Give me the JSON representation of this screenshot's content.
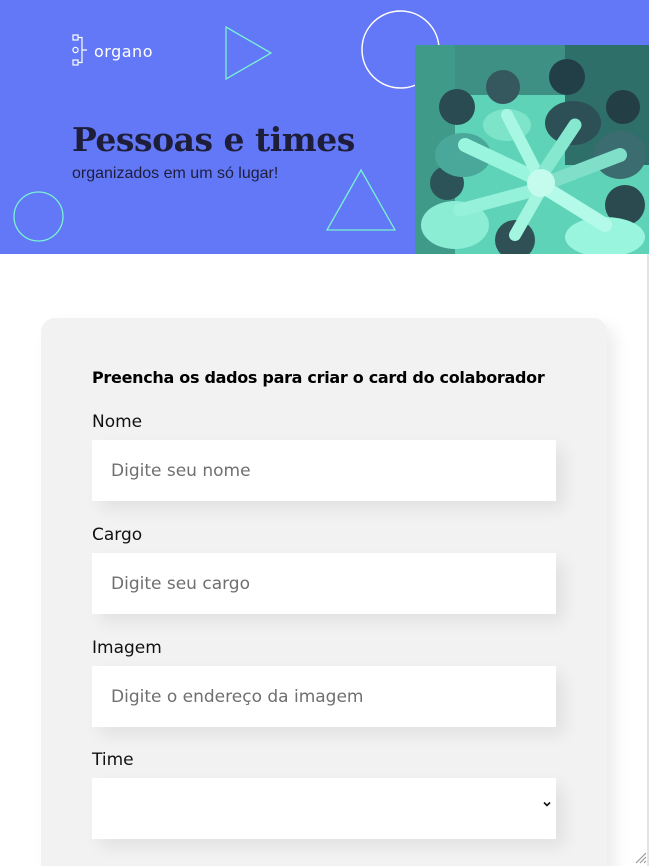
{
  "header": {
    "logo_text": "organo",
    "title": "Pessoas e times",
    "subtitle": "organizados em um só lugar!",
    "colors": {
      "background": "#6278f7",
      "title_text": "#1e1e3a",
      "decoration_white": "#ffffff",
      "decoration_aqua": "#7af2d2",
      "photo_tint": "#5fd3b8"
    },
    "photo_alt": "team-hands-photo"
  },
  "form": {
    "heading": "Preencha os dados para criar o card do colaborador",
    "fields": [
      {
        "label": "Nome",
        "placeholder": "Digite seu nome",
        "value": ""
      },
      {
        "label": "Cargo",
        "placeholder": "Digite seu cargo",
        "value": ""
      },
      {
        "label": "Imagem",
        "placeholder": "Digite o endereço da imagem",
        "value": ""
      }
    ],
    "select": {
      "label": "Time",
      "selected": ""
    },
    "colors": {
      "card_background": "#f2f2f2",
      "input_background": "#ffffff",
      "placeholder": "#6f6f6f"
    }
  },
  "icons": {
    "logo": "organization-chart-icon",
    "select_arrow": "chevron-down-icon",
    "resize": "resize-grip-icon"
  }
}
